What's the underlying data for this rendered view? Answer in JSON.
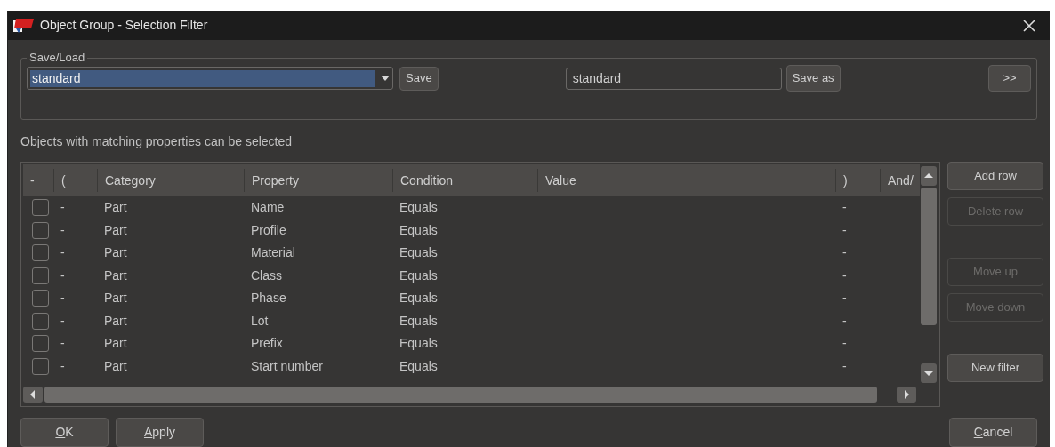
{
  "window": {
    "title": "Object Group - Selection Filter"
  },
  "save_load": {
    "legend": "Save/Load",
    "preset": "standard",
    "save_button": {
      "label": "Save"
    },
    "name_field": "standard",
    "save_as_button": {
      "label": "Save as"
    },
    "more_button": {
      "label": ">>"
    }
  },
  "hint": "Objects with matching properties can be selected",
  "table": {
    "columns": [
      "-",
      "(",
      "Category",
      "Property",
      "Condition",
      "Value",
      ")",
      "And/"
    ],
    "rows": [
      {
        "checked": false,
        "open": "-",
        "category": "Part",
        "property": "Name",
        "condition": "Equals",
        "value": "",
        "close": "-"
      },
      {
        "checked": false,
        "open": "-",
        "category": "Part",
        "property": "Profile",
        "condition": "Equals",
        "value": "",
        "close": "-"
      },
      {
        "checked": false,
        "open": "-",
        "category": "Part",
        "property": "Material",
        "condition": "Equals",
        "value": "",
        "close": "-"
      },
      {
        "checked": false,
        "open": "-",
        "category": "Part",
        "property": "Class",
        "condition": "Equals",
        "value": "",
        "close": "-"
      },
      {
        "checked": false,
        "open": "-",
        "category": "Part",
        "property": "Phase",
        "condition": "Equals",
        "value": "",
        "close": "-"
      },
      {
        "checked": false,
        "open": "-",
        "category": "Part",
        "property": "Lot",
        "condition": "Equals",
        "value": "",
        "close": "-"
      },
      {
        "checked": false,
        "open": "-",
        "category": "Part",
        "property": "Prefix",
        "condition": "Equals",
        "value": "",
        "close": "-"
      },
      {
        "checked": false,
        "open": "-",
        "category": "Part",
        "property": "Start number",
        "condition": "Equals",
        "value": "",
        "close": "-"
      }
    ]
  },
  "side_button_groups": [
    [
      {
        "label": "Add row",
        "disabled": false
      },
      {
        "label": "Delete row",
        "disabled": true
      }
    ],
    [
      {
        "label": "Move up",
        "disabled": true
      },
      {
        "label": "Move down",
        "disabled": true
      }
    ],
    [
      {
        "label": "New filter",
        "disabled": false
      }
    ]
  ],
  "bottom_buttons": [
    {
      "label": "OK",
      "underline_first": true
    },
    {
      "label": "Apply",
      "underline_first": true
    },
    {
      "label": "Cancel",
      "underline_first": true
    }
  ]
}
